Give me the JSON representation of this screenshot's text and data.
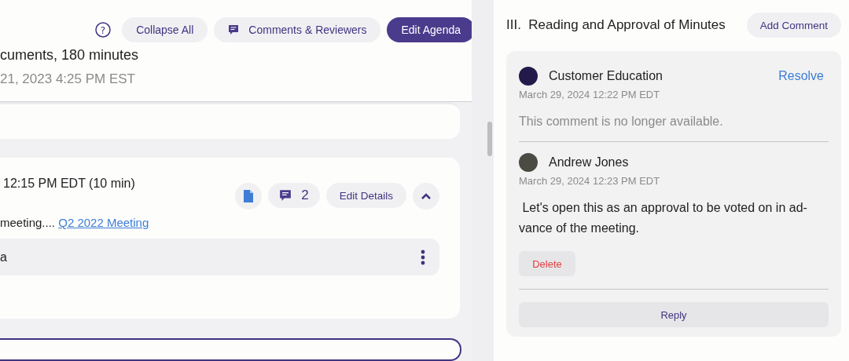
{
  "toolbar": {
    "help_icon": "?",
    "collapse_button": "Collapse All",
    "comments_button": "Comments & Reviewers",
    "edit_button": "Edit Agenda"
  },
  "meeting": {
    "summary": "cuments, 180 minutes",
    "date": "21, 2023 4:25 PM EST"
  },
  "agenda_item": {
    "time": "12:15 PM EDT (10 min)",
    "comment_count": "2",
    "edit_button": "Edit Details",
    "expanded": true,
    "description": "meeting....",
    "link": "Q2 2022 Meeting",
    "attachment": "a"
  },
  "panel": {
    "title": "III.  Reading and Approval of Minutes",
    "add_button": "Add Comment",
    "comments": [
      {
        "author": "Customer Education",
        "kind": "logo",
        "time": "March 29, 2024 12:22 PM EDT",
        "text": "This comment is no longer available.",
        "available": false,
        "action": "Resolve"
      },
      {
        "author": "Andrew Jones",
        "kind": "photo",
        "time": "March 29, 2024 12:23 PM EDT",
        "text": " Let's open this as an approval to be voted on in ad-vance of the meeting.",
        "available": true,
        "action": "Delete"
      }
    ],
    "reply_button": "Reply"
  }
}
